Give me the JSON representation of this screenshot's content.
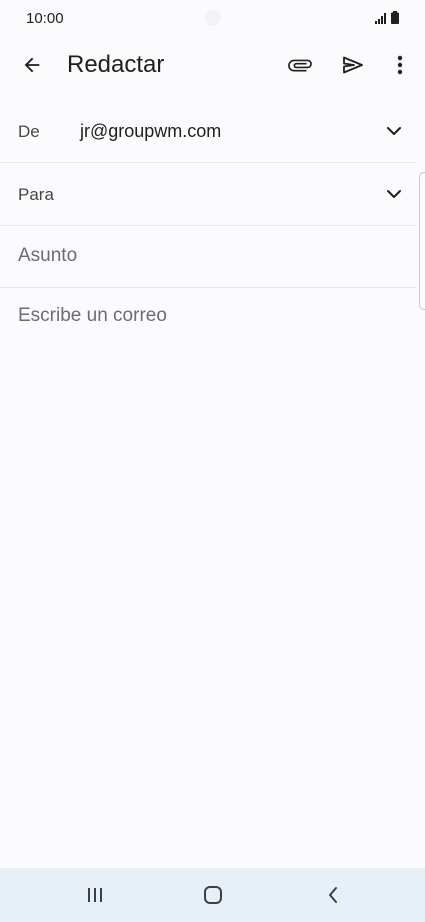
{
  "status_bar": {
    "time": "10:00",
    "icons": [
      "signal-icon",
      "battery-icon"
    ]
  },
  "toolbar": {
    "title": "Redactar",
    "icons": [
      "back-arrow-icon",
      "paperclip-icon",
      "send-icon",
      "more-vert-icon"
    ]
  },
  "compose": {
    "from_label": "De",
    "from_value": "jr@groupwm.com",
    "to_label": "Para",
    "subject_placeholder": "Asunto",
    "body_placeholder": "Escribe un correo"
  },
  "nav_bar": {
    "icons": [
      "recent-apps-icon",
      "home-icon",
      "back-icon"
    ]
  },
  "colors": {
    "background": "#fbfbfe",
    "nav_background": "#e7eff7",
    "text_primary": "#1f1f1f",
    "text_hint": "#6b6d70",
    "divider": "#e8e8ec"
  }
}
